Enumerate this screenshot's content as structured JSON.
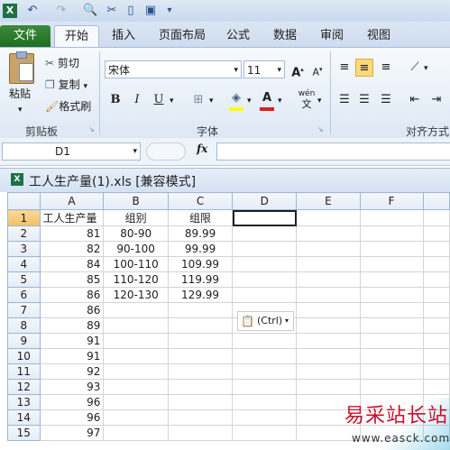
{
  "qat": {
    "icons": [
      "excel-logo-icon",
      "undo-icon",
      "redo-icon",
      "print-preview-icon",
      "cut-icon",
      "new-icon",
      "save-icon",
      "customize-icon"
    ]
  },
  "tabs": [
    "文件",
    "开始",
    "插入",
    "页面布局",
    "公式",
    "数据",
    "审阅",
    "视图"
  ],
  "clipboard": {
    "paste": "粘贴",
    "cut": "剪切",
    "copy": "复制",
    "format_painter": "格式刷",
    "group": "剪贴板"
  },
  "font": {
    "name": "宋体",
    "size": "11",
    "group": "字体",
    "bold": "B",
    "italic": "I",
    "underline": "U",
    "grow": "A",
    "shrink": "A",
    "wen": "wén\n文"
  },
  "alignment": {
    "group": "对齐方式"
  },
  "formula_bar": {
    "cell_ref": "D1",
    "fx": "fx",
    "value": ""
  },
  "workbook": {
    "title": "工人生产量(1).xls  [兼容模式]"
  },
  "sheet": {
    "columns": [
      "A",
      "B",
      "C",
      "D",
      "E",
      "F"
    ],
    "active_col": "D",
    "rows": [
      {
        "n": "1",
        "a": "工人生产量",
        "b": "组别",
        "c": "组限"
      },
      {
        "n": "2",
        "a": "81",
        "b": "80-90",
        "c": "89.99"
      },
      {
        "n": "3",
        "a": "82",
        "b": "90-100",
        "c": "99.99"
      },
      {
        "n": "4",
        "a": "84",
        "b": "100-110",
        "c": "109.99"
      },
      {
        "n": "5",
        "a": "85",
        "b": "110-120",
        "c": "119.99"
      },
      {
        "n": "6",
        "a": "86",
        "b": "120-130",
        "c": "129.99"
      },
      {
        "n": "7",
        "a": "86",
        "b": "",
        "c": ""
      },
      {
        "n": "8",
        "a": "89",
        "b": "",
        "c": ""
      },
      {
        "n": "9",
        "a": "91",
        "b": "",
        "c": ""
      },
      {
        "n": "10",
        "a": "91",
        "b": "",
        "c": ""
      },
      {
        "n": "11",
        "a": "92",
        "b": "",
        "c": ""
      },
      {
        "n": "12",
        "a": "93",
        "b": "",
        "c": ""
      },
      {
        "n": "13",
        "a": "96",
        "b": "",
        "c": ""
      },
      {
        "n": "14",
        "a": "96",
        "b": "",
        "c": ""
      },
      {
        "n": "15",
        "a": "97",
        "b": "",
        "c": ""
      }
    ]
  },
  "paste_options": {
    "label": "(Ctrl)"
  },
  "watermark": {
    "brand": "易采站长站",
    "url": "www.easck.com"
  },
  "colors": {
    "file_tab": "#2b7d2d",
    "active_header": "#f4c967",
    "font_color_bar": "#e01e1e",
    "fill_color_bar": "#ffff00",
    "watermark": "#c8102e"
  }
}
